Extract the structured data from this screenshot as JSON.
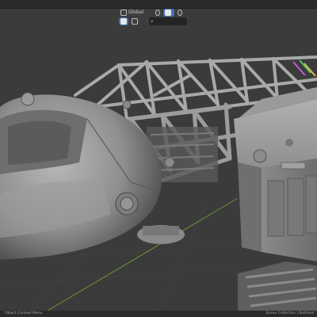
{
  "header": {
    "orientation_label": "Global",
    "search_placeholder": "",
    "accent": "#4772b3"
  },
  "status_bar": {
    "left_text": "Object Context Menu",
    "right_text": "Scene Collection | Buttress"
  },
  "icons": [
    "transform-orientation-icon",
    "pivot-icon",
    "snap-icon",
    "proportional-editing-icon",
    "filter-icon",
    "search-icon",
    "mouse-icon"
  ]
}
